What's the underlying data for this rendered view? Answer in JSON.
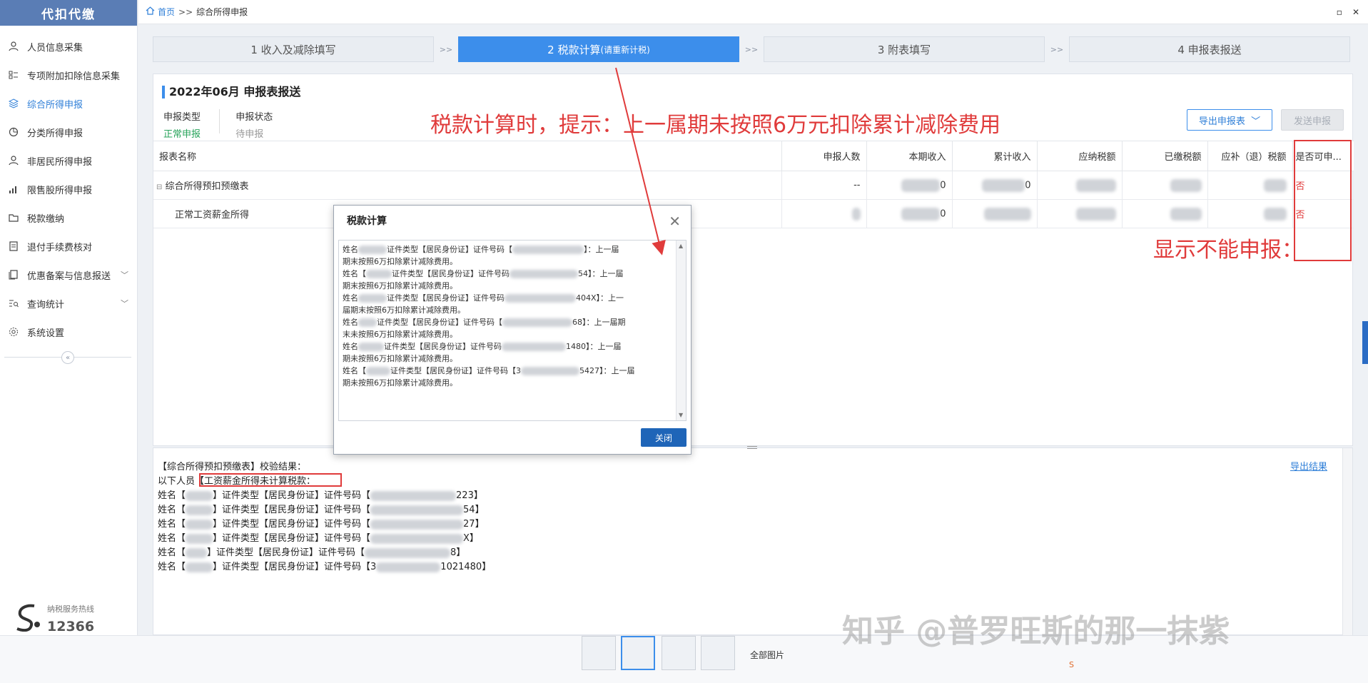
{
  "sidebar": {
    "logo": "代扣代缴",
    "items": [
      {
        "label": "人员信息采集",
        "icon": "user-icon"
      },
      {
        "label": "专项附加扣除信息采集",
        "icon": "list-icon"
      },
      {
        "label": "综合所得申报",
        "icon": "layers-icon"
      },
      {
        "label": "分类所得申报",
        "icon": "pie-icon"
      },
      {
        "label": "非居民所得申报",
        "icon": "user-icon"
      },
      {
        "label": "限售股所得申报",
        "icon": "bar-chart-icon"
      },
      {
        "label": "税款缴纳",
        "icon": "folder-icon"
      },
      {
        "label": "退付手续费核对",
        "icon": "document-icon"
      },
      {
        "label": "优惠备案与信息报送",
        "icon": "copy-icon"
      },
      {
        "label": "查询统计",
        "icon": "search-list-icon"
      },
      {
        "label": "系统设置",
        "icon": "gear-icon"
      }
    ],
    "active_index": 2,
    "hotline_label": "纳税服务热线",
    "hotline_number": "12366"
  },
  "breadcrumb": {
    "home": "首页",
    "sep": ">>",
    "current": "综合所得申报"
  },
  "steps": [
    {
      "label": "1 收入及减除填写",
      "sub": ""
    },
    {
      "label": "2 税款计算",
      "sub": "(请重新计税)"
    },
    {
      "label": "3 附表填写",
      "sub": ""
    },
    {
      "label": "4 申报表报送",
      "sub": ""
    }
  ],
  "step_arrow": ">>",
  "panel": {
    "title": "2022年06月 申报表报送",
    "type_label": "申报类型",
    "type_value": "正常申报",
    "status_label": "申报状态",
    "status_value": "待申报",
    "export_btn": "导出申报表",
    "send_btn": "发送申报"
  },
  "table": {
    "headers": [
      "报表名称",
      "申报人数",
      "本期收入",
      "累计收入",
      "应纳税额",
      "已缴税额",
      "应补（退）税额",
      "是否可申..."
    ],
    "rows": [
      {
        "name": "综合所得预扣预缴表",
        "count": "--",
        "income_tail": "0",
        "cum_tail": "0",
        "can": "否"
      },
      {
        "name": "正常工资薪金所得",
        "count": "",
        "income_tail": "0",
        "cum_tail": "",
        "can": "否"
      }
    ]
  },
  "dialog": {
    "title": "税款计算",
    "lines": [
      {
        "head": "姓名",
        "mid": "证件类型【居民身份证】证件号码【",
        "tail": "】：上一届",
        "cont": "期末按照6万扣除累计减除费用。"
      },
      {
        "head": "姓名【",
        "mid": "证件类型【居民身份证】证件号码",
        "tail": "54】：上一届",
        "cont": "期末按照6万扣除累计减除费用。"
      },
      {
        "head": "姓名",
        "mid": "证件类型【居民身份证】证件号码",
        "tail": "404X】：上一",
        "cont": "届期末按照6万扣除累计减除费用。"
      },
      {
        "head": "姓名",
        "mid": "证件类型【居民身份证】证件号码【",
        "tail": "68】：上一届期",
        "cont": "末未按照6万扣除累计减除费用。"
      },
      {
        "head": "姓名",
        "mid": "证件类型【居民身份证】证件号码",
        "tail": "1480】：上一届",
        "cont": "期未按照6万扣除累计减除费用。"
      },
      {
        "head": "姓名【",
        "mid": "证件类型【居民身份证】证件号码【3",
        "tail": "5427】：上一届",
        "cont": "期未按照6万扣除累计减除费用。"
      }
    ],
    "close_btn": "关闭"
  },
  "bottom": {
    "heading": "【综合所得预扣预缴表】校验结果：",
    "intro": "以下人员【工资薪金所得未计算税款：",
    "export_link": "导出结果",
    "rows": [
      {
        "prefix": "姓名【",
        "mid": "】证件类型【居民身份证】证件号码【",
        "tail": "223】"
      },
      {
        "prefix": "姓名【",
        "mid": "】证件类型【居民身份证】证件号码【",
        "tail": "54】"
      },
      {
        "prefix": "姓名【",
        "mid": "】证件类型【居民身份证】证件号码【",
        "tail": "27】"
      },
      {
        "prefix": "姓名【",
        "mid": "】证件类型【居民身份证】证件号码【",
        "tail": "X】"
      },
      {
        "prefix": "姓名【",
        "mid": "】证件类型【居民身份证】证件号码【",
        "tail": "8】"
      },
      {
        "prefix": "姓名【",
        "mid": "】证件类型【居民身份证】证件号码【3",
        "tail": "1021480】"
      }
    ]
  },
  "annotations": {
    "a1": "税款计算时，提示：上一属期未按照6万元扣除累计减除费用",
    "a2": "显示不能申报："
  },
  "thumbs_label": "全部图片",
  "watermark": "知乎 @普罗旺斯的那一抹紫",
  "colors": {
    "accent": "#3c8eeb",
    "annotation": "#e03b3b",
    "green": "#27a35a"
  }
}
